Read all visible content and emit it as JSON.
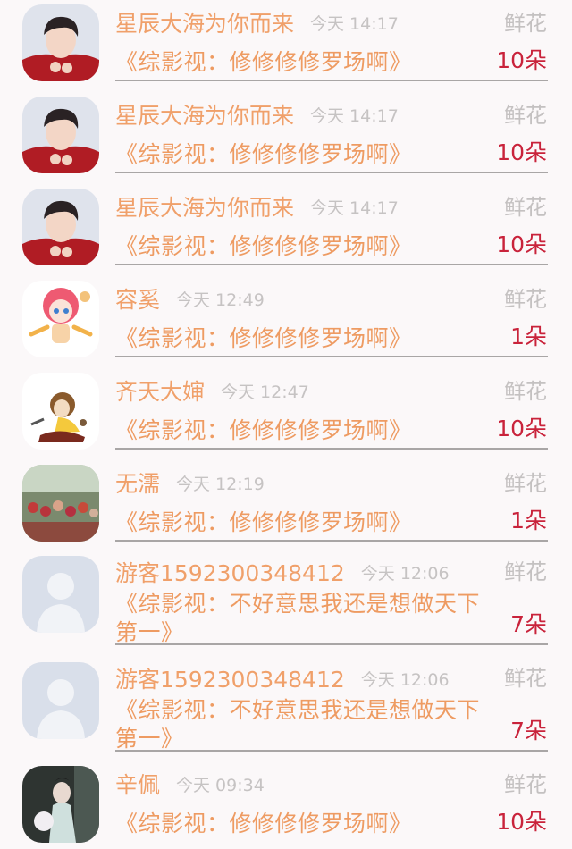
{
  "gift_label": "鲜花",
  "rows": [
    {
      "name": "星辰大海为你而来",
      "time": "今天 14:17",
      "title": "《综影视：修修修修罗场啊》",
      "count": "10朵",
      "avatar": "young-man-avatar"
    },
    {
      "name": "星辰大海为你而来",
      "time": "今天 14:17",
      "title": "《综影视：修修修修罗场啊》",
      "count": "10朵",
      "avatar": "young-man-avatar"
    },
    {
      "name": "星辰大海为你而来",
      "time": "今天 14:17",
      "title": "《综影视：修修修修罗场啊》",
      "count": "10朵",
      "avatar": "young-man-avatar"
    },
    {
      "name": "容奚",
      "time": "今天 12:49",
      "title": "《综影视：修修修修罗场啊》",
      "count": "1朵",
      "avatar": "anime-girl-avatar"
    },
    {
      "name": "齐天大婶",
      "time": "今天 12:47",
      "title": "《综影视：修修修修罗场啊》",
      "count": "10朵",
      "avatar": "illustration-avatar"
    },
    {
      "name": "无濡",
      "time": "今天 12:19",
      "title": "《综影视：修修修修罗场啊》",
      "count": "1朵",
      "avatar": "group-photo-avatar"
    },
    {
      "name": "游客1592300348412",
      "time": "今天 12:06",
      "title": "《综影视：不好意思我还是想做天下第一》",
      "count": "7朵",
      "avatar": "default-user-avatar"
    },
    {
      "name": "游客1592300348412",
      "time": "今天 12:06",
      "title": "《综影视：不好意思我还是想做天下第一》",
      "count": "7朵",
      "avatar": "default-user-avatar"
    },
    {
      "name": "辛佩",
      "time": "今天 09:34",
      "title": "《综影视：修修修修罗场啊》",
      "count": "10朵",
      "avatar": "costume-photo-avatar"
    }
  ]
}
